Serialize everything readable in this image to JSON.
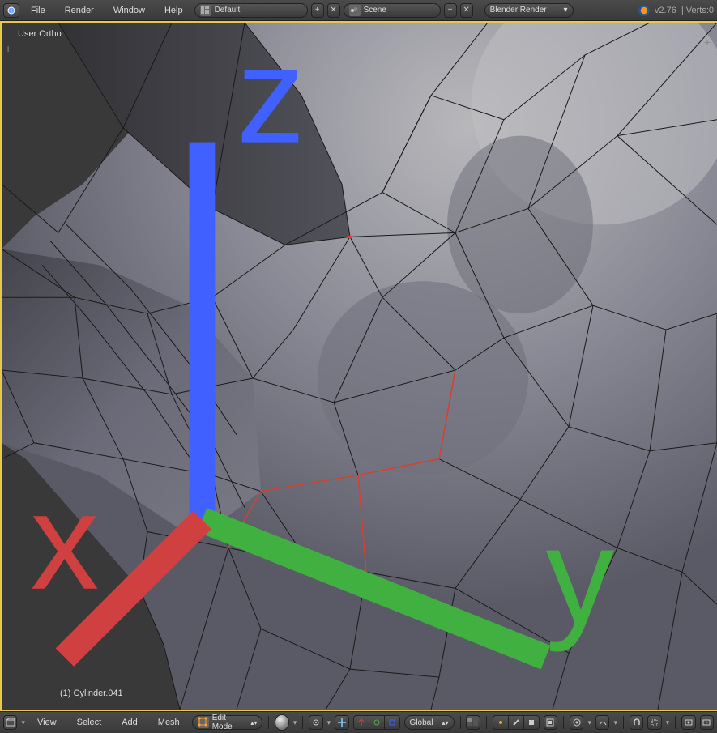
{
  "top_menu": {
    "items": [
      "File",
      "Render",
      "Window",
      "Help"
    ],
    "layout_field": {
      "value": "Default"
    },
    "scene_field": {
      "value": "Scene"
    },
    "engine_field": {
      "value": "Blender Render"
    },
    "version": "v2.76",
    "stats": "Verts:0"
  },
  "viewport": {
    "view_label": "User Ortho",
    "object_label": "(1) Cylinder.041",
    "axes": {
      "z": "z",
      "y": "y",
      "x": "x"
    }
  },
  "bottom_menu": {
    "items": [
      "View",
      "Select",
      "Add",
      "Mesh"
    ],
    "mode": "Edit Mode",
    "orientation": "Global"
  }
}
